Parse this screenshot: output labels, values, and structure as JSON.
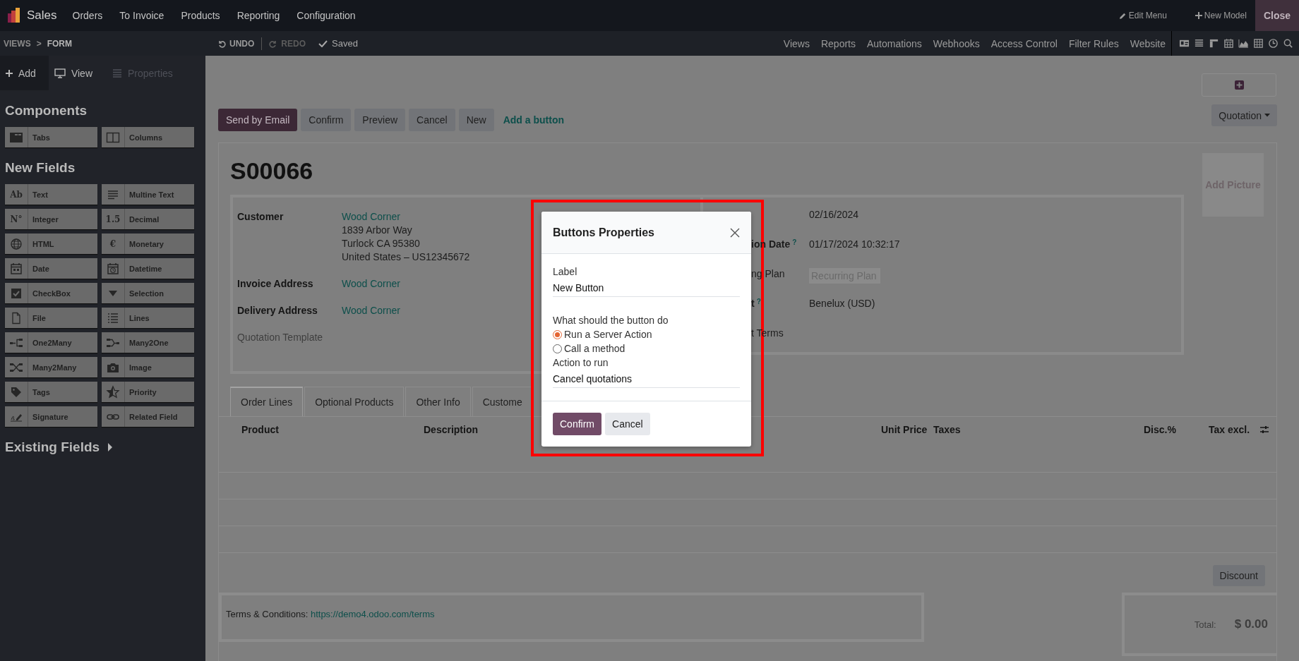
{
  "navbar": {
    "app": "Sales",
    "menus": [
      "Orders",
      "To Invoice",
      "Products",
      "Reporting",
      "Configuration"
    ],
    "actions": [
      {
        "label": "Edit Menu",
        "kind": "edit"
      },
      {
        "label": "New Model",
        "kind": "add"
      }
    ],
    "close": "Close"
  },
  "studio_bar": {
    "breadcrumbs": [
      "VIEWS",
      "FORM"
    ],
    "separator": ">",
    "undo": {
      "label": "UNDO",
      "disabled": false
    },
    "redo": {
      "label": "REDO",
      "disabled": true
    },
    "status": "Saved",
    "links": [
      "Views",
      "Reports",
      "Automations",
      "Webhooks",
      "Access Control",
      "Filter Rules",
      "Website"
    ]
  },
  "sidebar": {
    "tabs": [
      {
        "label": "Add",
        "kind": "add",
        "selected": true,
        "disabled": false
      },
      {
        "label": "View",
        "kind": "view",
        "selected": false,
        "disabled": false
      },
      {
        "label": "Properties",
        "kind": "properties",
        "selected": false,
        "disabled": true
      }
    ],
    "sections": [
      {
        "title": "Components",
        "items": [
          {
            "label": "Tabs",
            "kind": "tabs"
          },
          {
            "label": "Columns",
            "kind": "columns"
          }
        ]
      },
      {
        "title": "New Fields",
        "items": [
          {
            "label": "Text",
            "kind": "glyph",
            "glyph": "Ab"
          },
          {
            "label": "Multine Text",
            "kind": "multiline"
          },
          {
            "label": "Integer",
            "kind": "glyph",
            "glyph": "N°"
          },
          {
            "label": "Decimal",
            "kind": "glyph",
            "glyph": "1.5"
          },
          {
            "label": "HTML",
            "kind": "html"
          },
          {
            "label": "Monetary",
            "kind": "glyph",
            "glyph": "€"
          },
          {
            "label": "Date",
            "kind": "date"
          },
          {
            "label": "Datetime",
            "kind": "datetime"
          },
          {
            "label": "CheckBox",
            "kind": "checkbox"
          },
          {
            "label": "Selection",
            "kind": "selection"
          },
          {
            "label": "File",
            "kind": "file"
          },
          {
            "label": "Lines",
            "kind": "lines"
          },
          {
            "label": "One2Many",
            "kind": "one2many"
          },
          {
            "label": "Many2One",
            "kind": "many2one"
          },
          {
            "label": "Many2Many",
            "kind": "many2many"
          },
          {
            "label": "Image",
            "kind": "image"
          },
          {
            "label": "Tags",
            "kind": "tags"
          },
          {
            "label": "Priority",
            "kind": "priority"
          },
          {
            "label": "Signature",
            "kind": "signature"
          },
          {
            "label": "Related Field",
            "kind": "related"
          }
        ]
      }
    ],
    "existing_fields": "Existing Fields"
  },
  "form": {
    "header_buttons": [
      {
        "label": "Send by Email",
        "primary": true
      },
      {
        "label": "Confirm",
        "primary": false
      },
      {
        "label": "Preview",
        "primary": false
      },
      {
        "label": "Cancel",
        "primary": false
      },
      {
        "label": "New",
        "primary": false
      }
    ],
    "add_button": "Add a button",
    "status": "Quotation",
    "title": "S00066",
    "add_picture": "Add Picture",
    "left_fields": [
      {
        "label": "Customer",
        "muted": false,
        "link": "Wood Corner",
        "lines": [
          "1839 Arbor Way",
          "Turlock CA 95380",
          "United States – US12345672"
        ]
      },
      {
        "label": "Invoice Address",
        "muted": false,
        "link": "Wood Corner"
      },
      {
        "label": "Delivery Address",
        "muted": false,
        "link": "Wood Corner"
      },
      {
        "label": "Quotation Template",
        "muted": true
      }
    ],
    "right_fields": [
      {
        "value": "02/16/2024"
      },
      {
        "label": "ion Date",
        "help": "?",
        "value": "01/17/2024 10:32:17"
      },
      {
        "label": "ng Plan",
        "placeholder": "Recurring Plan"
      },
      {
        "label": "t",
        "help": "?",
        "value": "Benelux (USD)"
      },
      {
        "label": "t Terms"
      }
    ],
    "tabs": [
      {
        "label": "Order Lines",
        "selected": true
      },
      {
        "label": "Optional Products",
        "selected": false
      },
      {
        "label": "Other Info",
        "selected": false
      },
      {
        "label": "Custome",
        "selected": false
      }
    ],
    "columns": [
      "Product",
      "Description",
      "Unit Price",
      "Taxes",
      "Disc.%",
      "Tax excl."
    ],
    "discount": "Discount",
    "terms_label": "Terms & Conditions:",
    "terms_link": "https://demo4.odoo.com/terms",
    "total_label": "Total:",
    "total": "$ 0.00"
  },
  "dialog": {
    "title": "Buttons Properties",
    "label_caption": "Label",
    "label_value": "New Button",
    "question": "What should the button do",
    "options": [
      {
        "label": "Run a Server Action",
        "selected": true
      },
      {
        "label": "Call a method",
        "selected": false
      }
    ],
    "action_caption": "Action to run",
    "action_value": "Cancel quotations",
    "buttons": [
      {
        "label": "Confirm",
        "primary": true
      },
      {
        "label": "Cancel",
        "primary": false
      }
    ]
  }
}
